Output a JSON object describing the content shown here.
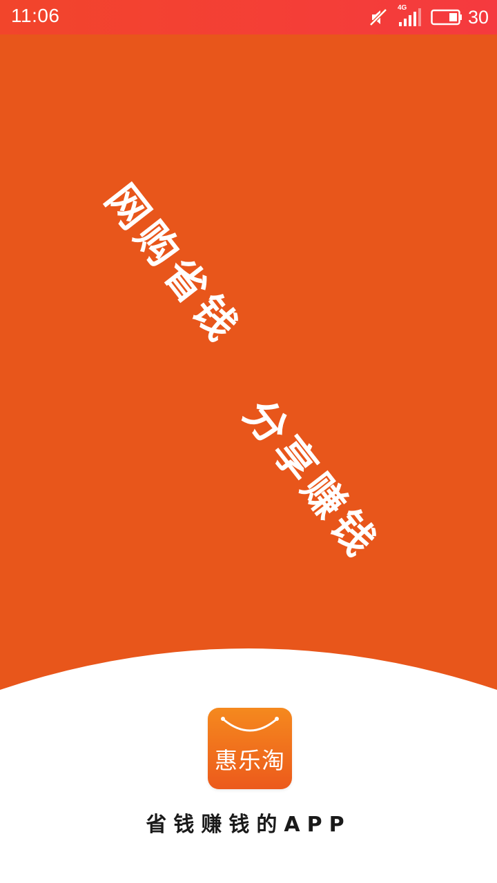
{
  "status_bar": {
    "time": "11:06",
    "network_label": "4G",
    "battery_level": "30",
    "icons": [
      "mute-icon",
      "signal-icon",
      "battery-icon"
    ]
  },
  "splash": {
    "slogan_line1": "网购省钱",
    "slogan_line2": "分享赚钱",
    "app_name": "惠乐淘",
    "tagline": "省钱赚钱的APP"
  },
  "colors": {
    "status_bar": "#f2452b",
    "hero_background": "#e8561b",
    "logo_gradient_top": "#f5891e",
    "logo_gradient_bottom": "#ec5a1c",
    "tagline_text": "#1a1a1a"
  }
}
